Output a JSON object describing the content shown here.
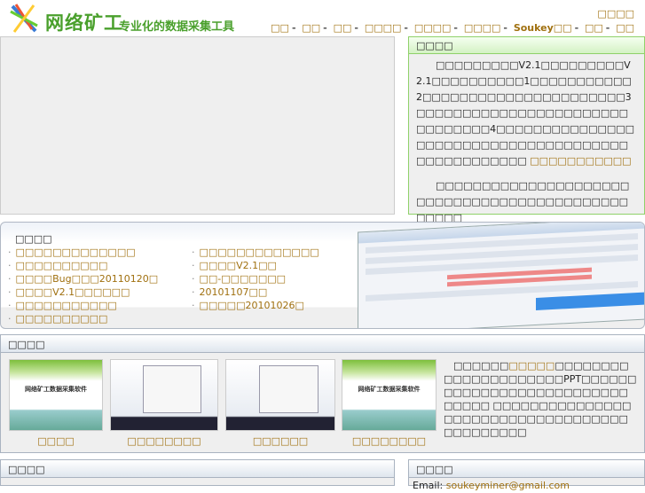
{
  "header": {
    "logo_title": "网络矿工",
    "logo_subtitle": "专业化的数据采集工具",
    "top_link": "□□□□",
    "nav": [
      "□□",
      "□□",
      "□□",
      "□□□□",
      "□□□□",
      "□□□□",
      "Soukey□□",
      "□□",
      "□□"
    ]
  },
  "intro": {
    "title": "□□□□",
    "para1": "□□□□□□□□□V2.1□□□□□□□□□V2.1□□□□□□□□□□1□□□□□□□□□□□2□□□□□□□□□□□□□□□□□□□□□□3□□□□□□□□□□□□□□□□□□□□□□□□□□□□□□□4□□□□□□□□□□□□□□□□□□□□□□□□□□□□□□□□□□□□□□□□□□□□□□□□□□ ",
    "para1_link": "□□□□□□□□□□□",
    "para2": "□□□□□□□□□□□□□□□□□□□□□□□□□□□□□□□□□□□□□□□□□□□□□□□□□"
  },
  "news": {
    "title": "□□□□",
    "items": [
      "□□□□□□□□□□□□□",
      "□□□□□□□□□□□□□",
      "□□□□□□□□□□",
      "□□□□V2.1□□",
      "□□□□Bug□□□20110120□",
      "□□-□□□□□□□",
      "□□□□V2.1□□□□□□",
      "20101107□□",
      "□□□□□□□□□□□",
      "□□□□□20101026□",
      "□□□□□□□□□□"
    ]
  },
  "gallery": {
    "title": "□□□□",
    "thumb_text": "网络矿工数据采集软件",
    "items": [
      "□□□□",
      "□□□□□□□□",
      "□□□□□□",
      "□□□□□□□□"
    ],
    "text_pre": "□□□□□□",
    "text_link": "□□□□□",
    "text_post": "□□□□□□□□□□□□□□□□□□□□□PPT□□□□□□□□□□□□□□□□□□□□□□□□□□□□□□□ □□□□□□□□□□□□□□□□□□□□□□□□□□□□□□□□□□□□□□□□□□□□"
  },
  "bottom_left": {
    "title": "□□□□"
  },
  "bottom_right": {
    "title": "□□□□",
    "email_label": "Email:",
    "email": "soukeyminer@gmail.com"
  }
}
